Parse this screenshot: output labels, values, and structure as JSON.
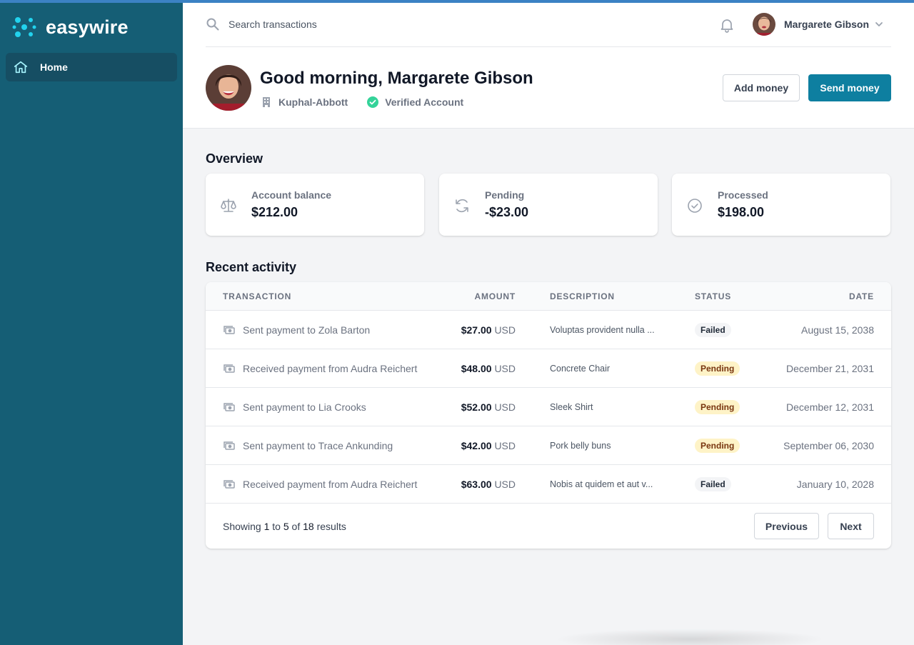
{
  "app": {
    "name": "easywire"
  },
  "sidebar": {
    "items": [
      {
        "label": "Home",
        "icon": "home-icon"
      }
    ]
  },
  "search": {
    "placeholder": "Search transactions",
    "value": ""
  },
  "user": {
    "name": "Margarete Gibson"
  },
  "profile": {
    "greeting": "Good morning, Margarete Gibson",
    "company": "Kuphal-Abbott",
    "verified_label": "Verified Account"
  },
  "actions": {
    "add_money": "Add money",
    "send_money": "Send money"
  },
  "overview": {
    "title": "Overview",
    "cards": [
      {
        "label": "Account balance",
        "value": "$212.00",
        "icon": "scale-icon"
      },
      {
        "label": "Pending",
        "value": "-$23.00",
        "icon": "refresh-icon"
      },
      {
        "label": "Processed",
        "value": "$198.00",
        "icon": "check-circle-icon"
      }
    ]
  },
  "activity": {
    "title": "Recent activity",
    "columns": [
      "TRANSACTION",
      "AMOUNT",
      "DESCRIPTION",
      "STATUS",
      "DATE"
    ],
    "rows": [
      {
        "transaction": "Sent payment to Zola Barton",
        "amount": "$27.00",
        "currency": "USD",
        "description": "Voluptas provident nulla ...",
        "status": "Failed",
        "date": "August 15, 2038"
      },
      {
        "transaction": "Received payment from Audra Reichert",
        "amount": "$48.00",
        "currency": "USD",
        "description": "Concrete Chair",
        "status": "Pending",
        "date": "December 21, 2031"
      },
      {
        "transaction": "Sent payment to Lia Crooks",
        "amount": "$52.00",
        "currency": "USD",
        "description": "Sleek Shirt",
        "status": "Pending",
        "date": "December 12, 2031"
      },
      {
        "transaction": "Sent payment to Trace Ankunding",
        "amount": "$42.00",
        "currency": "USD",
        "description": "Pork belly buns",
        "status": "Pending",
        "date": "September 06, 2030"
      },
      {
        "transaction": "Received payment from Audra Reichert",
        "amount": "$63.00",
        "currency": "USD",
        "description": "Nobis at quidem et aut v...",
        "status": "Failed",
        "date": "January 10, 2028"
      }
    ],
    "pagination": {
      "prefix": "Showing",
      "from": "1",
      "to_word": "to",
      "to": "5",
      "of_word": "of",
      "total": "18",
      "suffix": "results",
      "previous": "Previous",
      "next": "Next"
    }
  },
  "colors": {
    "sidebar": "#155e75",
    "accent": "#0e7fa0",
    "logo_mark": "#22d3ee",
    "verified": "#34d399"
  }
}
